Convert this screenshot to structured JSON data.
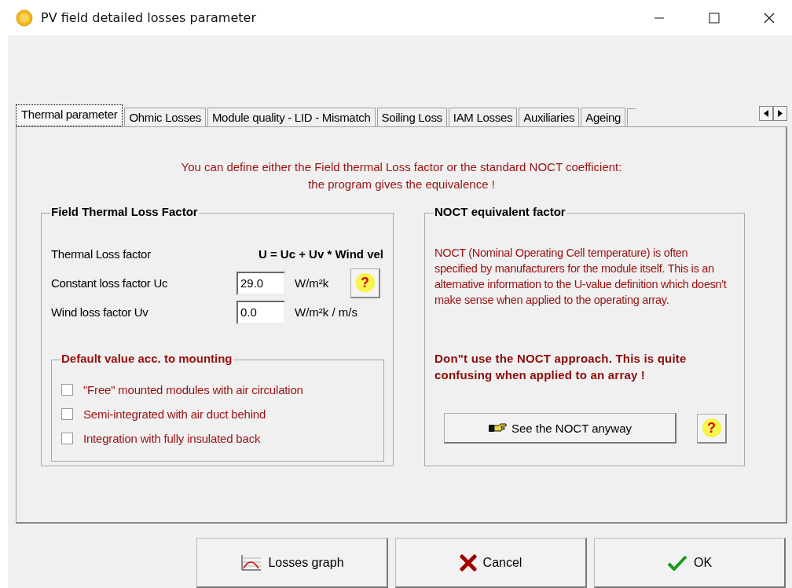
{
  "window": {
    "title": "PV field detailed losses parameter"
  },
  "tabs": [
    {
      "label": "Thermal parameter",
      "selected": true
    },
    {
      "label": "Ohmic Losses",
      "selected": false
    },
    {
      "label": "Module quality - LID - Mismatch",
      "selected": false
    },
    {
      "label": "Soiling Loss",
      "selected": false
    },
    {
      "label": "IAM Losses",
      "selected": false
    },
    {
      "label": "Auxiliaries",
      "selected": false
    },
    {
      "label": "Ageing",
      "selected": false
    }
  ],
  "intro": [
    "You can define either the Field thermal Loss factor or the standard NOCT coefficient:",
    "the program gives the equivalence !"
  ],
  "thermal_group": {
    "title": "Field Thermal Loss Factor",
    "formula_label": "Thermal Loss factor",
    "formula": "U = Uc + Uv * Wind vel",
    "fields": [
      {
        "label": "Constant loss factor  Uc",
        "value": "29.0",
        "unit": "W/m²k",
        "help": "?"
      },
      {
        "label": "Wind loss factor  Uv",
        "value": "0.0",
        "unit": "W/m²k / m/s"
      }
    ],
    "mounting": {
      "title": "Default value acc. to mounting",
      "options": [
        {
          "label": "\"Free\" mounted modules with air circulation",
          "checked": false
        },
        {
          "label": "Semi-integrated with air duct behind",
          "checked": false
        },
        {
          "label": "Integration with fully insulated back",
          "checked": false
        }
      ]
    }
  },
  "noct_group": {
    "title": "NOCT equivalent factor",
    "description": "NOCT  (Nominal Operating Cell temperature) is often specified by manufacturers  for the module itself. This is an alternative information to the U-value definition which doesn't make sense when applied to the operating array.",
    "warning": "Don\"t use the NOCT approach. This is quite confusing when applied to an array !",
    "button": "See the NOCT anyway",
    "help": "?"
  },
  "buttons": [
    {
      "label": "Losses graph",
      "kind": "graph"
    },
    {
      "label": "Cancel",
      "kind": "cancel"
    },
    {
      "label": "OK",
      "kind": "ok"
    }
  ]
}
